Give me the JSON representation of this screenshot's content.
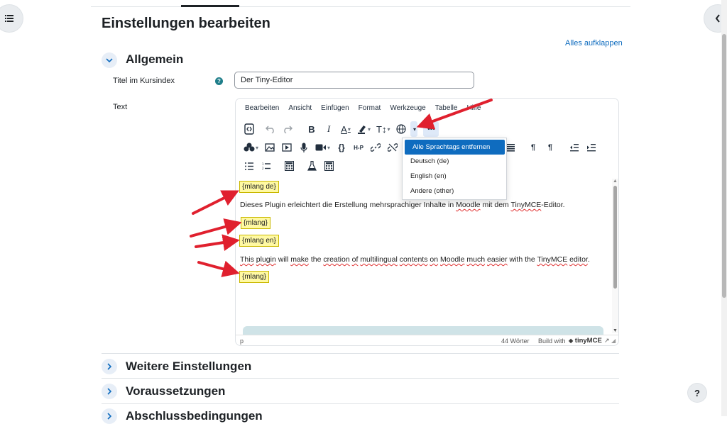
{
  "page": {
    "title": "Einstellungen bearbeiten",
    "expand_all": "Alles aufklappen"
  },
  "sections": [
    {
      "title": "Allgemein",
      "expanded": true
    },
    {
      "title": "Weitere Einstellungen",
      "expanded": false
    },
    {
      "title": "Voraussetzungen",
      "expanded": false
    },
    {
      "title": "Abschlussbedingungen",
      "expanded": false
    }
  ],
  "form": {
    "title_label": "Titel im Kursindex",
    "title_value": "Der Tiny-Editor",
    "text_label": "Text"
  },
  "editor": {
    "menu": [
      "Bearbeiten",
      "Ansicht",
      "Einfügen",
      "Format",
      "Werkzeuge",
      "Tabelle",
      "Hilfe"
    ],
    "content": {
      "tag1": "{mlang de}",
      "para_de_before": "Dieses Plugin erleichtert die Erstellung mehrsprachiger Inhalte in ",
      "para_de_w1": "Moodle",
      "para_de_mid": " mit dem ",
      "para_de_w2": "TinyMCE",
      "para_de_after": "-Editor.",
      "tag2": "{mlang}",
      "tag3": "{mlang en}",
      "para_en_w1": "This",
      "para_en_s1": " ",
      "para_en_w2": "plugin",
      "para_en_s2": " will ",
      "para_en_w3": "make",
      "para_en_s3": " the ",
      "para_en_w4": "creation",
      "para_en_s4": " ",
      "para_en_w5": "of",
      "para_en_s5": " ",
      "para_en_w6": "multilingual",
      "para_en_s6": " ",
      "para_en_w7": "contents",
      "para_en_s7": " ",
      "para_en_w8": "on",
      "para_en_s8": " ",
      "para_en_w9": "Moodle",
      "para_en_s9": " ",
      "para_en_w10": "much",
      "para_en_s10": " ",
      "para_en_w11": "easier",
      "para_en_s11": " with the ",
      "para_en_w12": "TinyMCE",
      "para_en_s12": " ",
      "para_en_w13": "editor",
      "para_en_end": ".",
      "tag4": "{mlang}"
    },
    "status": {
      "path": "p",
      "word_count": "44 Wörter",
      "build_with": "Build with",
      "brand": "tinyMCE"
    },
    "language_dropdown": [
      "Alle Sprachtags entfernen",
      "Deutsch (de)",
      "English (en)",
      "Andere (other)"
    ]
  },
  "toolbar_labels": {
    "bold": "B",
    "italic": "I",
    "font_color": "A",
    "font_size": "T↕",
    "more": "•••",
    "braces": "{}",
    "h5p": "H-P"
  },
  "help_button": "?",
  "colors": {
    "accent": "#0f6cbf",
    "highlight": "#fff9a3",
    "arrow": "#e0202e"
  }
}
